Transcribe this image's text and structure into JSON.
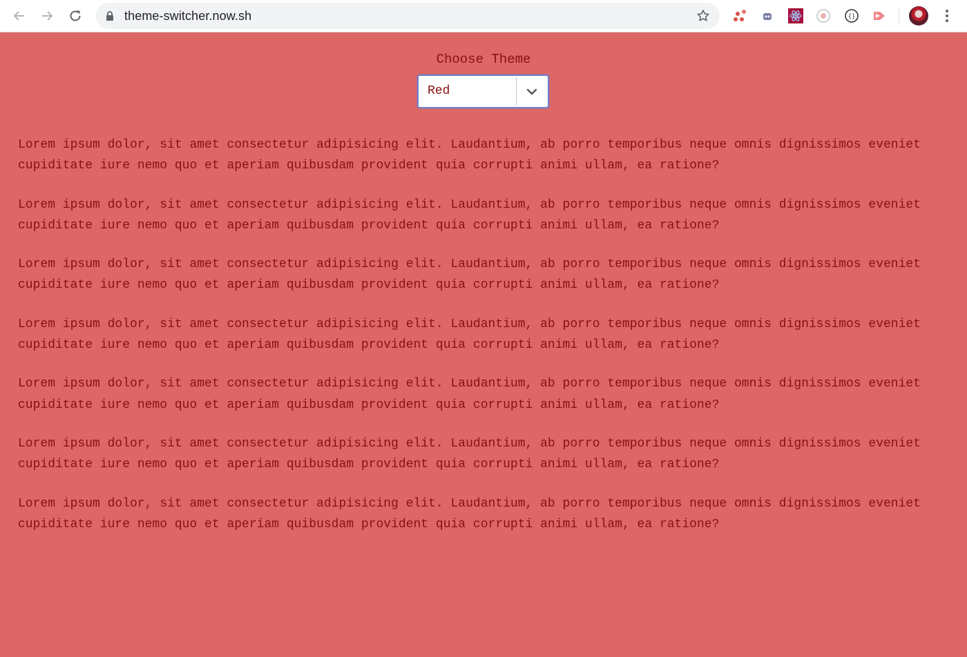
{
  "browser": {
    "url": "theme-switcher.now.sh",
    "extensions": [
      "graph-extension-icon",
      "bot-extension-icon",
      "react-devtools-icon",
      "record-extension-icon",
      "json-extension-icon",
      "play-extension-icon"
    ]
  },
  "page": {
    "theme_label": "Choose Theme",
    "theme_select": {
      "selected": "Red"
    },
    "paragraphs": [
      "Lorem ipsum dolor, sit amet consectetur adipisicing elit. Laudantium, ab porro temporibus neque omnis dignissimos eveniet cupiditate iure nemo quo et aperiam quibusdam provident quia corrupti animi ullam, ea ratione?",
      "Lorem ipsum dolor, sit amet consectetur adipisicing elit. Laudantium, ab porro temporibus neque omnis dignissimos eveniet cupiditate iure nemo quo et aperiam quibusdam provident quia corrupti animi ullam, ea ratione?",
      "Lorem ipsum dolor, sit amet consectetur adipisicing elit. Laudantium, ab porro temporibus neque omnis dignissimos eveniet cupiditate iure nemo quo et aperiam quibusdam provident quia corrupti animi ullam, ea ratione?",
      "Lorem ipsum dolor, sit amet consectetur adipisicing elit. Laudantium, ab porro temporibus neque omnis dignissimos eveniet cupiditate iure nemo quo et aperiam quibusdam provident quia corrupti animi ullam, ea ratione?",
      "Lorem ipsum dolor, sit amet consectetur adipisicing elit. Laudantium, ab porro temporibus neque omnis dignissimos eveniet cupiditate iure nemo quo et aperiam quibusdam provident quia corrupti animi ullam, ea ratione?",
      "Lorem ipsum dolor, sit amet consectetur adipisicing elit. Laudantium, ab porro temporibus neque omnis dignissimos eveniet cupiditate iure nemo quo et aperiam quibusdam provident quia corrupti animi ullam, ea ratione?",
      "Lorem ipsum dolor, sit amet consectetur adipisicing elit. Laudantium, ab porro temporibus neque omnis dignissimos eveniet cupiditate iure nemo quo et aperiam quibusdam provident quia corrupti animi ullam, ea ratione?"
    ]
  },
  "colors": {
    "background": "#dd6666",
    "text": "#8b1111",
    "select_border": "#6f7fc8"
  }
}
